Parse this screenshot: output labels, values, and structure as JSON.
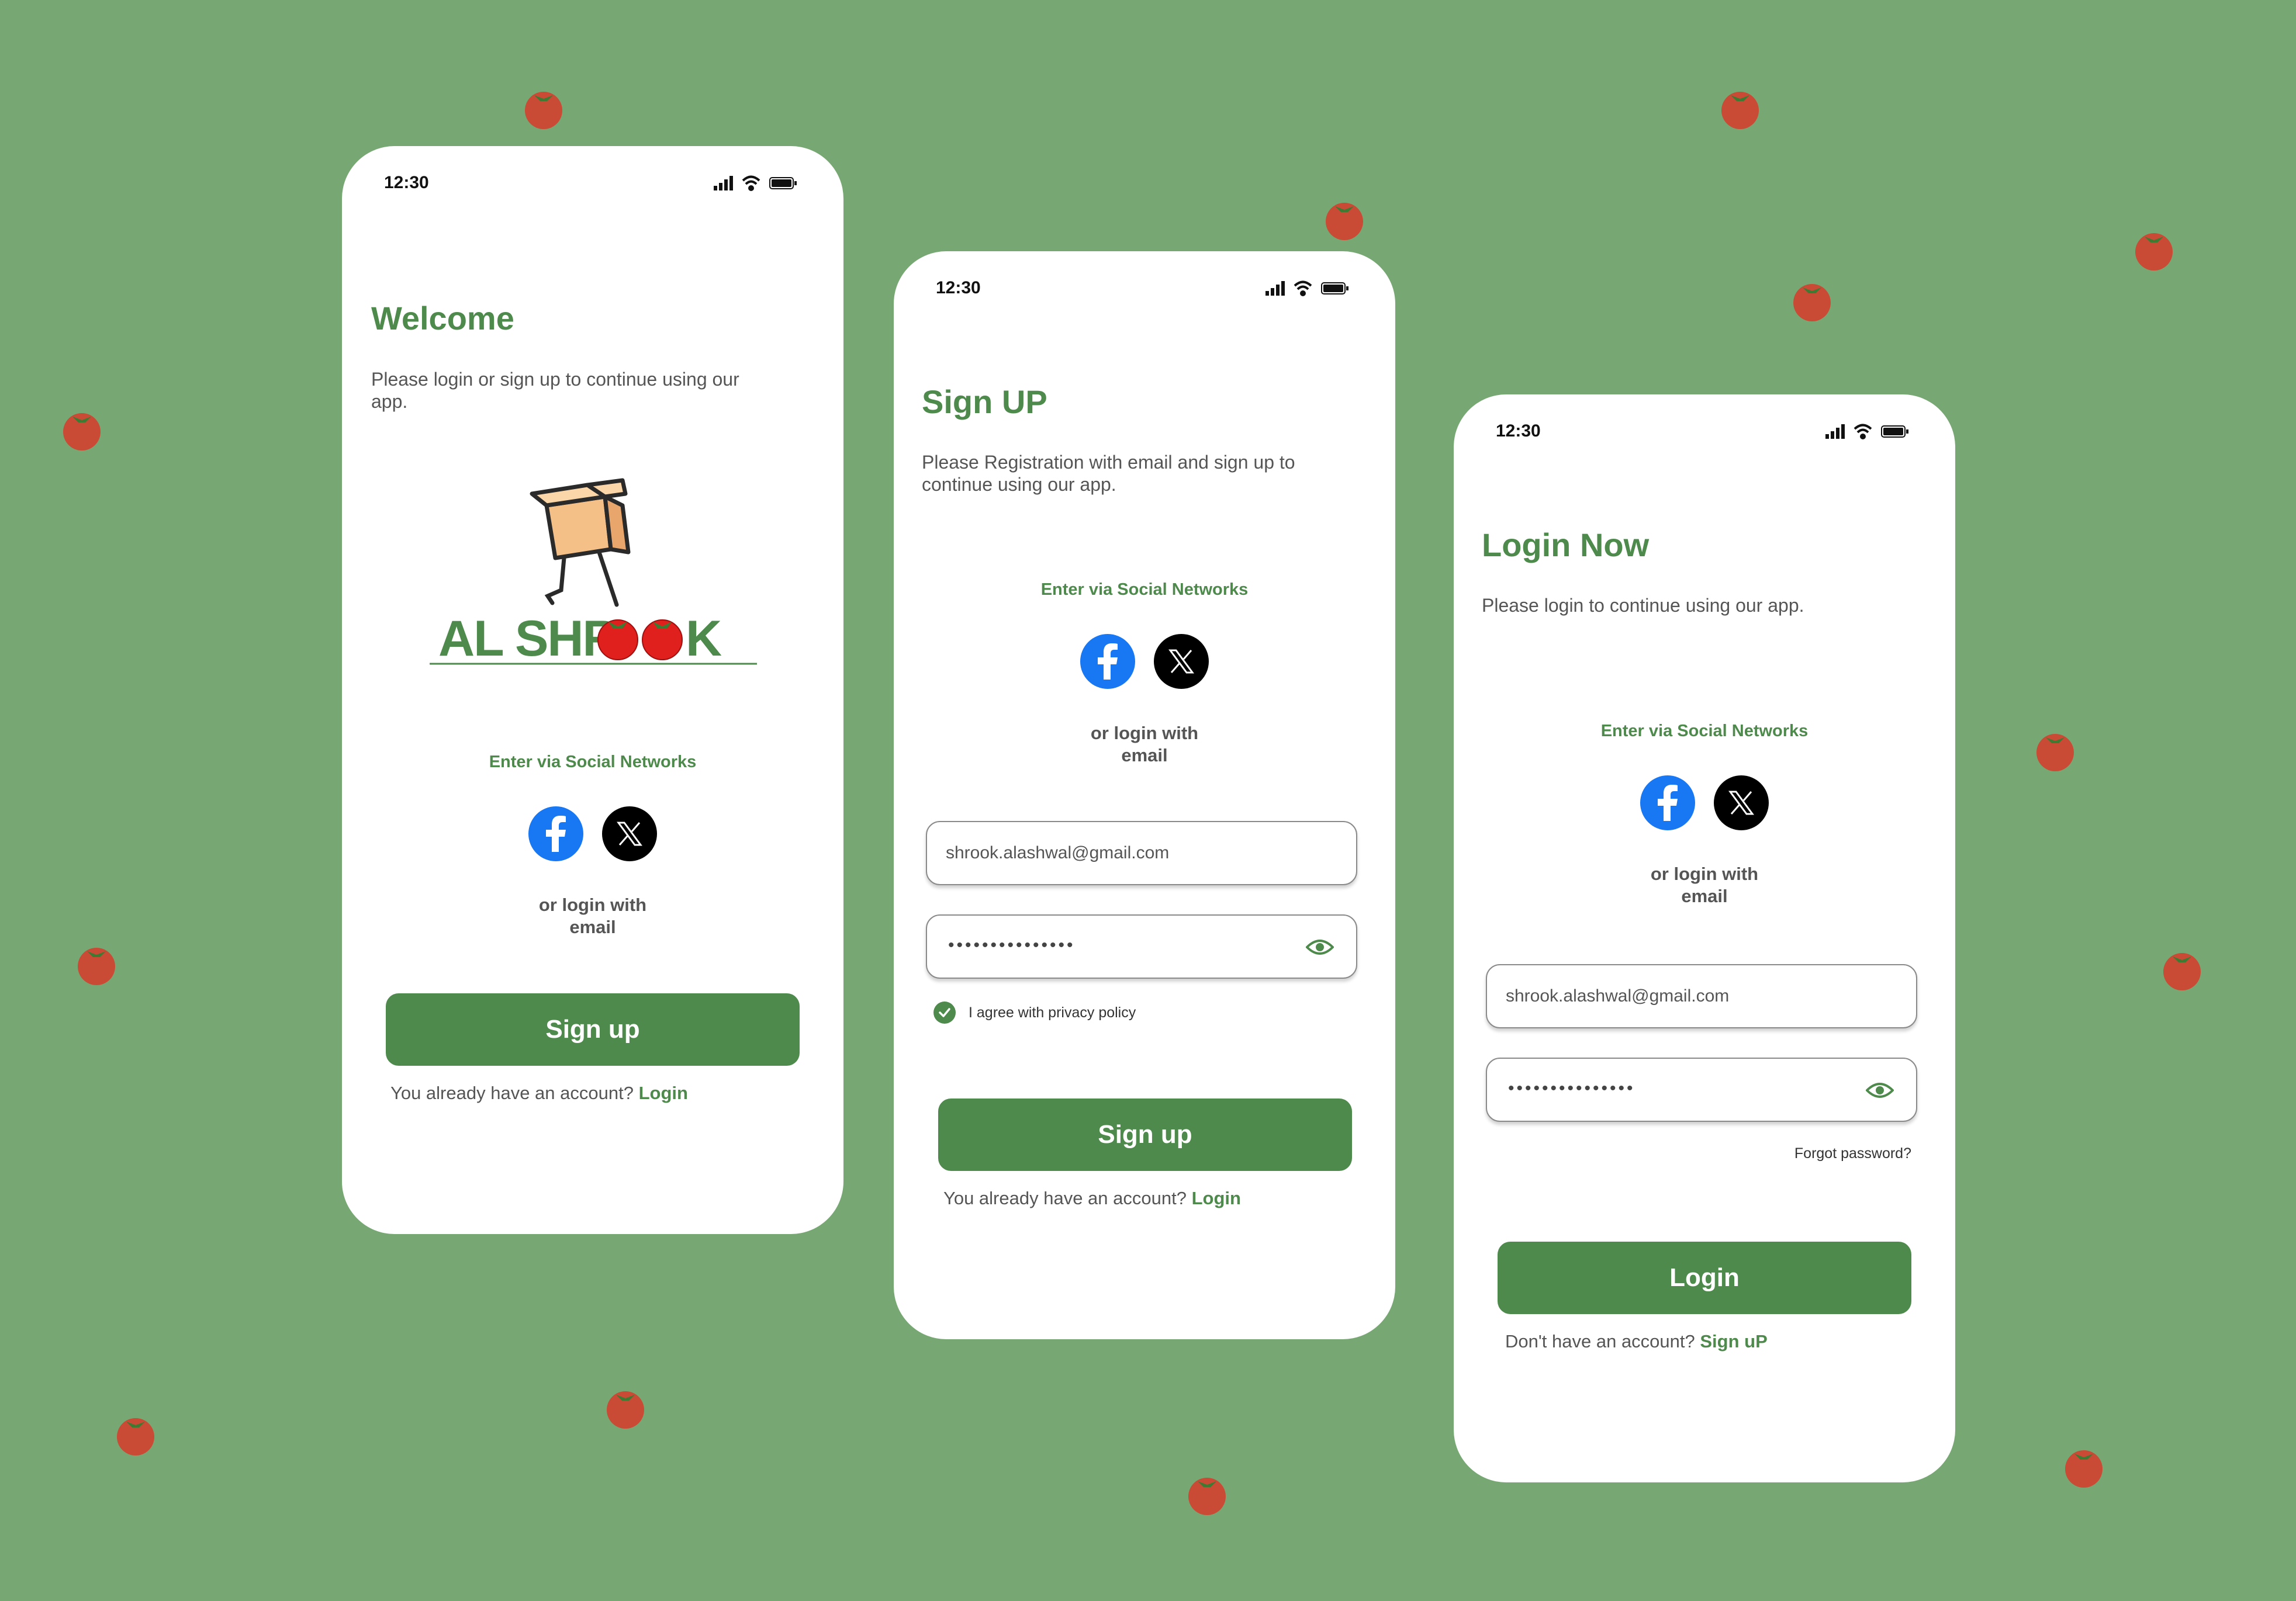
{
  "colors": {
    "background": "#77a873",
    "brand_green": "#4e8a4c",
    "facebook_blue": "#1877f2",
    "tomato_red": "#c94b35"
  },
  "welcome": {
    "time": "12:30",
    "title": "Welcome",
    "subtitle": "Please login or sign up to continue using our app.",
    "social_label": "Enter via Social Networks",
    "or_line1": "or login with",
    "or_line2": "email",
    "signup_button": "Sign up",
    "footer_text": "You already have an account? ",
    "footer_link": "Login"
  },
  "signup": {
    "time": "12:30",
    "title": "Sign UP",
    "subtitle": "Please Registration with email and sign up to continue using our app.",
    "social_label": "Enter via Social Networks",
    "or_line1": "or login with",
    "or_line2": "email",
    "email_value": "shrook.alashwal@gmail.com",
    "password_masked": "•••••••••••••••",
    "agree_text": "I agree with privacy policy",
    "agree_checked": true,
    "signup_button": "Sign up",
    "footer_text": "You already have an account? ",
    "footer_link": "Login"
  },
  "login": {
    "time": "12:30",
    "title": "Login Now",
    "subtitle": "Please login to continue using our app.",
    "social_label": "Enter via Social Networks",
    "or_line1": "or login with",
    "or_line2": "email",
    "email_value": "shrook.alashwal@gmail.com",
    "password_masked": "•••••••••••••••",
    "forgot_password": "Forgot password?",
    "login_button": "Login",
    "footer_text": "Don't have an account? ",
    "footer_link": "Sign uP"
  },
  "icons": [
    "signal-icon",
    "wifi-icon",
    "battery-icon",
    "facebook-icon",
    "x-icon",
    "eye-icon",
    "check-icon",
    "tomato-icon",
    "box-mascot-icon"
  ]
}
